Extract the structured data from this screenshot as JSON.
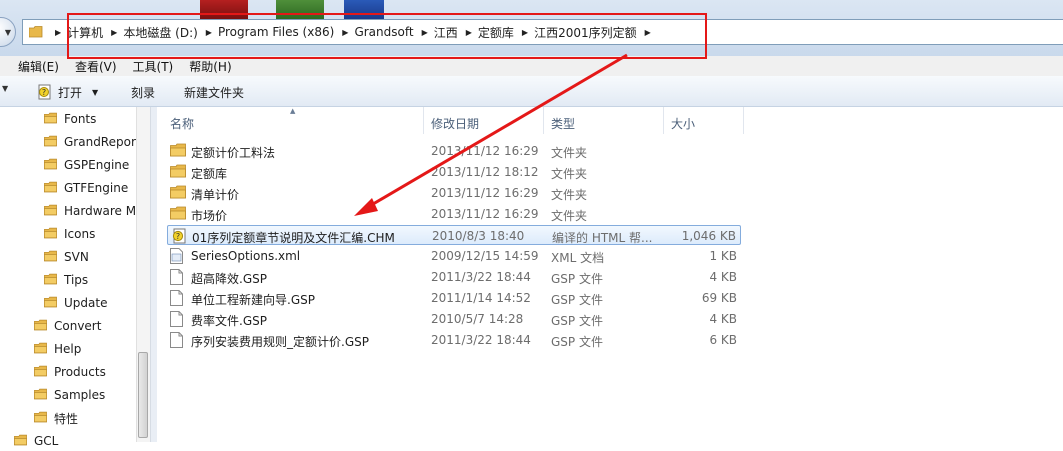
{
  "address": {
    "crumbs": [
      "计算机",
      "本地磁盘 (D:)",
      "Program Files (x86)",
      "Grandsoft",
      "江西",
      "定额库",
      "江西2001序列定额"
    ]
  },
  "menu": [
    "编辑(E)",
    "查看(V)",
    "工具(T)",
    "帮助(H)"
  ],
  "toolbar": {
    "open": "打开",
    "burn": "刻录",
    "new_folder": "新建文件夹"
  },
  "nav": [
    {
      "label": "Fonts",
      "indent": 1
    },
    {
      "label": "GrandRepor",
      "indent": 1
    },
    {
      "label": "GSPEngine",
      "indent": 1
    },
    {
      "label": "GTFEngine",
      "indent": 1
    },
    {
      "label": "Hardware M",
      "indent": 1
    },
    {
      "label": "Icons",
      "indent": 1
    },
    {
      "label": "SVN",
      "indent": 1
    },
    {
      "label": "Tips",
      "indent": 1
    },
    {
      "label": "Update",
      "indent": 1
    },
    {
      "label": "Convert",
      "indent": 0
    },
    {
      "label": "Help",
      "indent": 0
    },
    {
      "label": "Products",
      "indent": 0
    },
    {
      "label": "Samples",
      "indent": 0
    },
    {
      "label": "特性",
      "indent": 0
    },
    {
      "label": "GCL",
      "indent": -1
    }
  ],
  "columns": {
    "name": "名称",
    "date": "修改日期",
    "type": "类型",
    "size": "大小"
  },
  "files": [
    {
      "name": "定额计价工料法",
      "date": "2013/11/12 16:29",
      "type": "文件夹",
      "size": "",
      "icon": "folder-icon"
    },
    {
      "name": "定额库",
      "date": "2013/11/12 18:12",
      "type": "文件夹",
      "size": "",
      "icon": "folder-icon"
    },
    {
      "name": "清单计价",
      "date": "2013/11/12 16:29",
      "type": "文件夹",
      "size": "",
      "icon": "folder-icon"
    },
    {
      "name": "市场价",
      "date": "2013/11/12 16:29",
      "type": "文件夹",
      "size": "",
      "icon": "folder-icon"
    },
    {
      "name": "01序列定额章节说明及文件汇编.CHM",
      "date": "2010/8/3 18:40",
      "type": "编译的 HTML 帮...",
      "size": "1,046 KB",
      "icon": "chm-help-icon",
      "selected": true
    },
    {
      "name": "SeriesOptions.xml",
      "date": "2009/12/15 14:59",
      "type": "XML 文档",
      "size": "1 KB",
      "icon": "xml-file-icon"
    },
    {
      "name": "超高降效.GSP",
      "date": "2011/3/22 18:44",
      "type": "GSP 文件",
      "size": "4 KB",
      "icon": "file-icon"
    },
    {
      "name": "单位工程新建向导.GSP",
      "date": "2011/1/14 14:52",
      "type": "GSP 文件",
      "size": "69 KB",
      "icon": "file-icon"
    },
    {
      "name": "费率文件.GSP",
      "date": "2010/5/7 14:28",
      "type": "GSP 文件",
      "size": "4 KB",
      "icon": "file-icon"
    },
    {
      "name": "序列安装费用规则_定额计价.GSP",
      "date": "2011/3/22 18:44",
      "type": "GSP 文件",
      "size": "6 KB",
      "icon": "file-icon"
    }
  ],
  "colors": {
    "annotation": "#e41818",
    "selection_border": "#84acdd",
    "folder": "#e8b84a"
  }
}
